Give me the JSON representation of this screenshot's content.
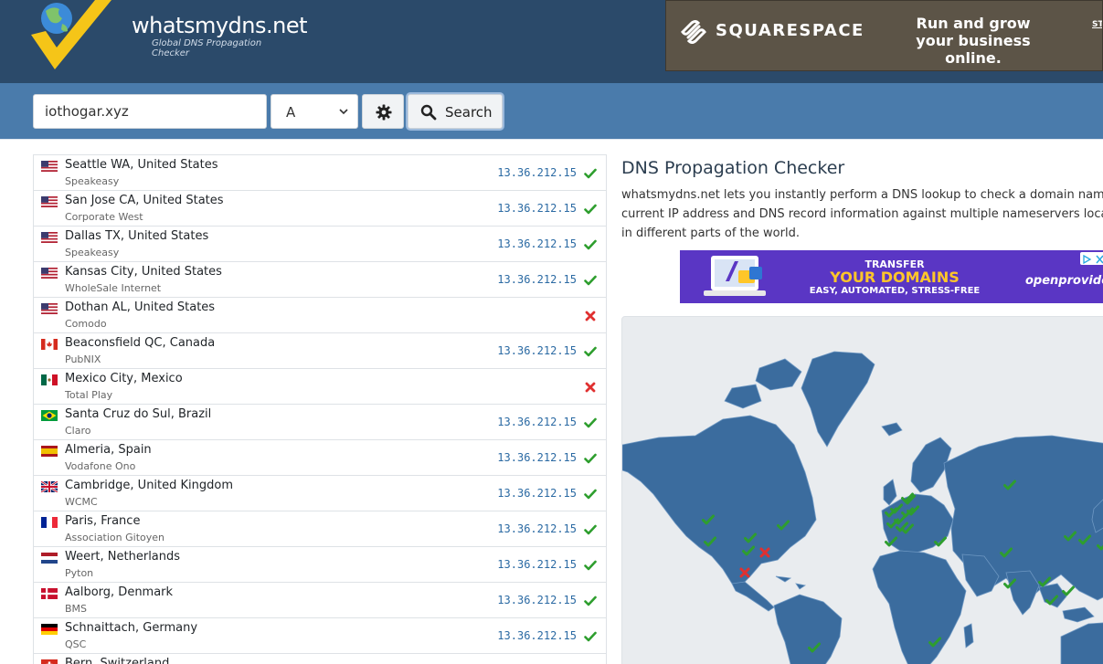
{
  "brand": {
    "title": "whatsmydns.net",
    "subtitle": "Global DNS Propagation Checker"
  },
  "ad_top": {
    "brand": "SQUARESPACE",
    "tagline": "Run and grow your business online.",
    "cta": "ST"
  },
  "search": {
    "domain_value": "iothogar.xyz",
    "record_type": "A",
    "settings_icon": "gear-icon",
    "button_label": "Search",
    "button_icon": "search-icon"
  },
  "results": [
    {
      "flag": "us",
      "location": "Seattle WA, United States",
      "provider": "Speakeasy",
      "ip": "13.36.212.15",
      "status": "ok"
    },
    {
      "flag": "us",
      "location": "San Jose CA, United States",
      "provider": "Corporate West",
      "ip": "13.36.212.15",
      "status": "ok"
    },
    {
      "flag": "us",
      "location": "Dallas TX, United States",
      "provider": "Speakeasy",
      "ip": "13.36.212.15",
      "status": "ok"
    },
    {
      "flag": "us",
      "location": "Kansas City, United States",
      "provider": "WholeSale Internet",
      "ip": "13.36.212.15",
      "status": "ok"
    },
    {
      "flag": "us",
      "location": "Dothan AL, United States",
      "provider": "Comodo",
      "ip": "",
      "status": "fail"
    },
    {
      "flag": "ca",
      "location": "Beaconsfield QC, Canada",
      "provider": "PubNIX",
      "ip": "13.36.212.15",
      "status": "ok"
    },
    {
      "flag": "mx",
      "location": "Mexico City, Mexico",
      "provider": "Total Play",
      "ip": "",
      "status": "fail"
    },
    {
      "flag": "br",
      "location": "Santa Cruz do Sul, Brazil",
      "provider": "Claro",
      "ip": "13.36.212.15",
      "status": "ok"
    },
    {
      "flag": "es",
      "location": "Almeria, Spain",
      "provider": "Vodafone Ono",
      "ip": "13.36.212.15",
      "status": "ok"
    },
    {
      "flag": "gb",
      "location": "Cambridge, United Kingdom",
      "provider": "WCMC",
      "ip": "13.36.212.15",
      "status": "ok"
    },
    {
      "flag": "fr",
      "location": "Paris, France",
      "provider": "Association Gitoyen",
      "ip": "13.36.212.15",
      "status": "ok"
    },
    {
      "flag": "nl",
      "location": "Weert, Netherlands",
      "provider": "Pyton",
      "ip": "13.36.212.15",
      "status": "ok"
    },
    {
      "flag": "dk",
      "location": "Aalborg, Denmark",
      "provider": "BMS",
      "ip": "13.36.212.15",
      "status": "ok"
    },
    {
      "flag": "de",
      "location": "Schnaittach, Germany",
      "provider": "QSC",
      "ip": "13.36.212.15",
      "status": "ok"
    },
    {
      "flag": "ch",
      "location": "Bern, Switzerland",
      "provider": "",
      "ip": "",
      "status": "none"
    }
  ],
  "info": {
    "title": "DNS Propagation Checker",
    "text": "whatsmydns.net lets you instantly perform a DNS lookup to check a domain name's current IP address and DNS record information against multiple nameservers located in different parts of the world."
  },
  "ad_mid": {
    "line1": "TRANSFER",
    "line2": "YOUR DOMAINS",
    "line3": "EASY, AUTOMATED, STRESS-FREE",
    "brand": "openprovider"
  },
  "map": {
    "markers": [
      {
        "status": "ok"
      },
      {
        "status": "ok"
      },
      {
        "status": "ok"
      },
      {
        "status": "ok"
      },
      {
        "status": "fail"
      },
      {
        "status": "ok"
      },
      {
        "status": "fail"
      },
      {
        "status": "ok"
      },
      {
        "status": "ok"
      },
      {
        "status": "ok"
      },
      {
        "status": "ok"
      },
      {
        "status": "ok"
      },
      {
        "status": "ok"
      },
      {
        "status": "ok"
      },
      {
        "status": "ok"
      },
      {
        "status": "ok"
      },
      {
        "status": "ok"
      },
      {
        "status": "ok"
      },
      {
        "status": "ok"
      },
      {
        "status": "ok"
      },
      {
        "status": "ok"
      },
      {
        "status": "ok"
      },
      {
        "status": "ok"
      },
      {
        "status": "ok"
      },
      {
        "status": "ok"
      },
      {
        "status": "ok"
      },
      {
        "status": "ok"
      },
      {
        "status": "ok"
      },
      {
        "status": "ok"
      },
      {
        "status": "ok"
      }
    ]
  },
  "colors": {
    "header_bg": "#2b4a6a",
    "search_bg": "#4a7bab",
    "ok": "#2e9e2e",
    "fail": "#e03030",
    "land": "#3b6c9e",
    "ip_text": "#2b6aa3"
  }
}
